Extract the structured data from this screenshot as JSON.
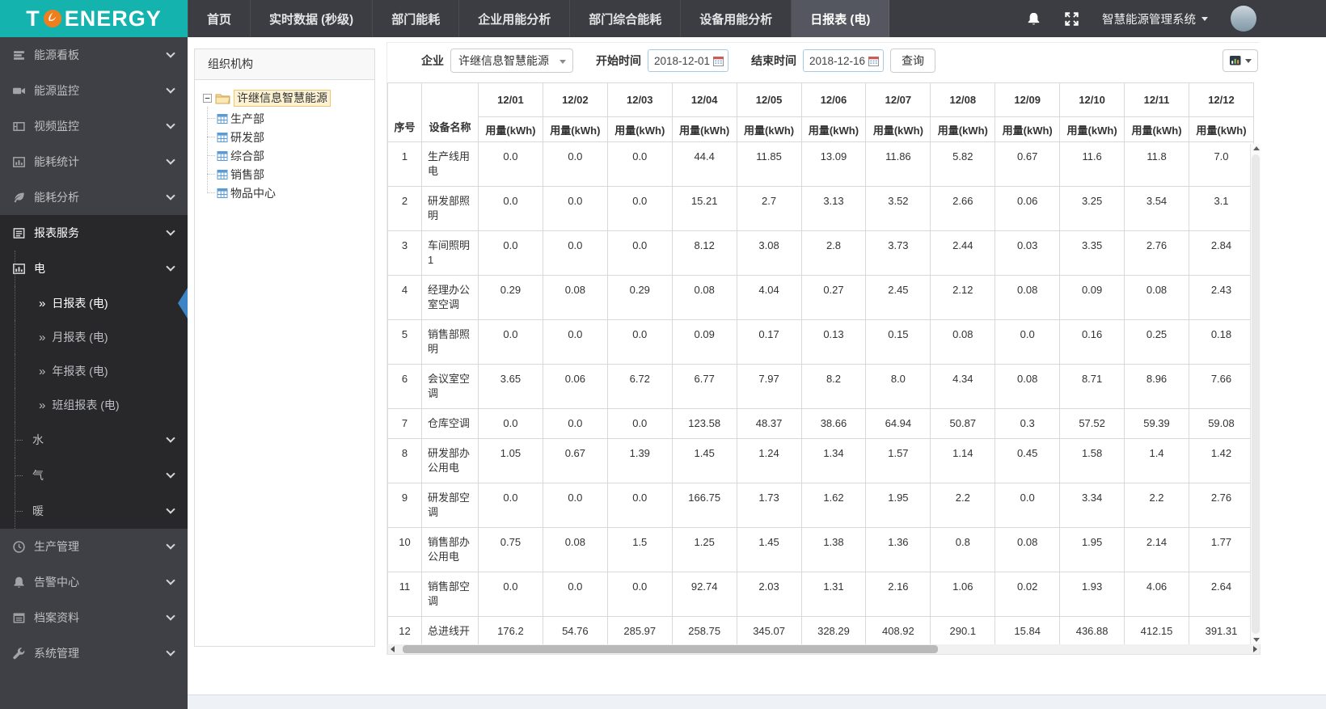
{
  "brand": {
    "prefix": "T",
    "suffix": "ENERGY"
  },
  "topnav": {
    "tabs": [
      {
        "label": "首页"
      },
      {
        "label": "实时数据 (秒级)"
      },
      {
        "label": "部门能耗"
      },
      {
        "label": "企业用能分析"
      },
      {
        "label": "部门综合能耗"
      },
      {
        "label": "设备用能分析"
      },
      {
        "label": "日报表 (电)",
        "active": true
      }
    ]
  },
  "user_area": {
    "system_title": "智慧能源管理系统"
  },
  "sidebar": {
    "items": [
      {
        "label": "能源看板",
        "icon": "dashboard-icon",
        "level": 0
      },
      {
        "label": "能源监控",
        "icon": "camera-icon",
        "level": 0
      },
      {
        "label": "视频监控",
        "icon": "film-icon",
        "level": 0
      },
      {
        "label": "能耗统计",
        "icon": "stats-icon",
        "level": 0
      },
      {
        "label": "能耗分析",
        "icon": "leaf-icon",
        "level": 0
      },
      {
        "label": "报表服务",
        "icon": "report-icon",
        "level": 0,
        "dark": true,
        "open": true
      },
      {
        "label": "电",
        "icon": "chart-icon",
        "level": 1,
        "dark": true,
        "open": true,
        "guide": true
      },
      {
        "label": "日报表 (电)",
        "level": 2,
        "dark": true,
        "active": true,
        "guide": true
      },
      {
        "label": "月报表 (电)",
        "level": 2,
        "dark": true,
        "guide": true
      },
      {
        "label": "年报表 (电)",
        "level": 2,
        "dark": true,
        "guide": true
      },
      {
        "label": "班组报表 (电)",
        "level": 2,
        "dark": true,
        "guide": true
      },
      {
        "label": "水",
        "level": 1,
        "dark": true,
        "guide": true,
        "stub": true
      },
      {
        "label": "气",
        "level": 1,
        "dark": true,
        "guide": true,
        "stub": true
      },
      {
        "label": "暖",
        "level": 1,
        "dark": true,
        "guide": true,
        "stub": true
      },
      {
        "label": "生产管理",
        "icon": "clock-icon",
        "level": 0
      },
      {
        "label": "告警中心",
        "icon": "alarm-icon",
        "level": 0
      },
      {
        "label": "档案资料",
        "icon": "archive-icon",
        "level": 0
      },
      {
        "label": "系统管理",
        "icon": "wrench-icon",
        "level": 0
      }
    ]
  },
  "tree": {
    "header": "组织机构",
    "root": "许继信息智慧能源",
    "children": [
      "生产部",
      "研发部",
      "综合部",
      "销售部",
      "物品中心"
    ]
  },
  "filters": {
    "company_label": "企业",
    "company_value": "许继信息智慧能源",
    "start_label": "开始时间",
    "start_value": "2018-12-01",
    "end_label": "结束时间",
    "end_value": "2018-12-16",
    "query_label": "查询"
  },
  "table": {
    "col_seq": "序号",
    "col_device": "设备名称",
    "usage_label": "用量(kWh)",
    "dates": [
      "12/01",
      "12/02",
      "12/03",
      "12/04",
      "12/05",
      "12/06",
      "12/07",
      "12/08",
      "12/09",
      "12/10",
      "12/11",
      "12/12"
    ],
    "rows": [
      {
        "seq": "1",
        "name": "生产线用电",
        "values": [
          "0.0",
          "0.0",
          "0.0",
          "44.4",
          "11.85",
          "13.09",
          "11.86",
          "5.82",
          "0.67",
          "11.6",
          "11.8",
          "7.0"
        ]
      },
      {
        "seq": "2",
        "name": "研发部照明",
        "values": [
          "0.0",
          "0.0",
          "0.0",
          "15.21",
          "2.7",
          "3.13",
          "3.52",
          "2.66",
          "0.06",
          "3.25",
          "3.54",
          "3.1"
        ]
      },
      {
        "seq": "3",
        "name": "车间照明1",
        "values": [
          "0.0",
          "0.0",
          "0.0",
          "8.12",
          "3.08",
          "2.8",
          "3.73",
          "2.44",
          "0.03",
          "3.35",
          "2.76",
          "2.84"
        ]
      },
      {
        "seq": "4",
        "name": "经理办公室空调",
        "values": [
          "0.29",
          "0.08",
          "0.29",
          "0.08",
          "4.04",
          "0.27",
          "2.45",
          "2.12",
          "0.08",
          "0.09",
          "0.08",
          "2.43"
        ]
      },
      {
        "seq": "5",
        "name": "销售部照明",
        "values": [
          "0.0",
          "0.0",
          "0.0",
          "0.09",
          "0.17",
          "0.13",
          "0.15",
          "0.08",
          "0.0",
          "0.16",
          "0.25",
          "0.18"
        ]
      },
      {
        "seq": "6",
        "name": "会议室空调",
        "values": [
          "3.65",
          "0.06",
          "6.72",
          "6.77",
          "7.97",
          "8.2",
          "8.0",
          "4.34",
          "0.08",
          "8.71",
          "8.96",
          "7.66"
        ]
      },
      {
        "seq": "7",
        "name": "仓库空调",
        "values": [
          "0.0",
          "0.0",
          "0.0",
          "123.58",
          "48.37",
          "38.66",
          "64.94",
          "50.87",
          "0.3",
          "57.52",
          "59.39",
          "59.08"
        ]
      },
      {
        "seq": "8",
        "name": "研发部办公用电",
        "values": [
          "1.05",
          "0.67",
          "1.39",
          "1.45",
          "1.24",
          "1.34",
          "1.57",
          "1.14",
          "0.45",
          "1.58",
          "1.4",
          "1.42"
        ]
      },
      {
        "seq": "9",
        "name": "研发部空调",
        "values": [
          "0.0",
          "0.0",
          "0.0",
          "166.75",
          "1.73",
          "1.62",
          "1.95",
          "2.2",
          "0.0",
          "3.34",
          "2.2",
          "2.76"
        ]
      },
      {
        "seq": "10",
        "name": "销售部办公用电",
        "values": [
          "0.75",
          "0.08",
          "1.5",
          "1.25",
          "1.45",
          "1.38",
          "1.36",
          "0.8",
          "0.08",
          "1.95",
          "2.14",
          "1.77"
        ]
      },
      {
        "seq": "11",
        "name": "销售部空调",
        "values": [
          "0.0",
          "0.0",
          "0.0",
          "92.74",
          "2.03",
          "1.31",
          "2.16",
          "1.06",
          "0.02",
          "1.93",
          "4.06",
          "2.64"
        ]
      },
      {
        "seq": "12",
        "name": "总进线开",
        "values": [
          "176.2",
          "54.76",
          "285.97",
          "258.75",
          "345.07",
          "328.29",
          "408.92",
          "290.1",
          "15.84",
          "436.88",
          "412.15",
          "391.31"
        ]
      }
    ]
  },
  "colors": {
    "accent_teal": "#15b3ad",
    "active_marker_blue": "#3d84c6",
    "tree_highlight": "#fdf3d4"
  }
}
